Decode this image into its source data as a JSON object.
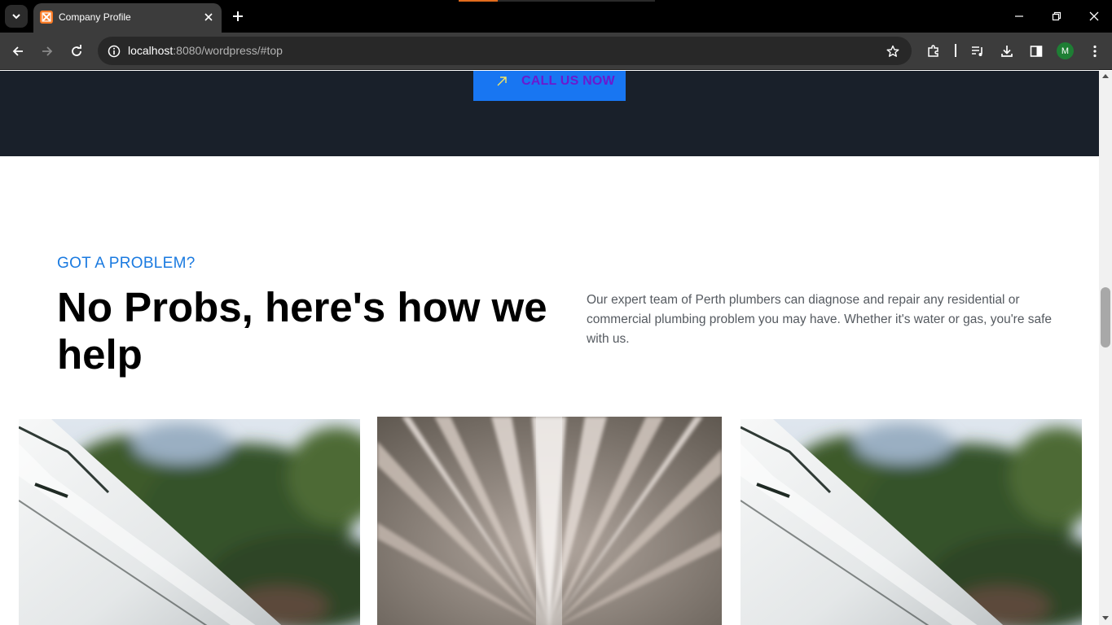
{
  "browser": {
    "tab": {
      "title": "Company Profile",
      "favicon": "xampp-icon"
    },
    "address": {
      "host": "localhost",
      "rest": ":8080/wordpress/#top"
    },
    "profile_initial": "M",
    "colors": {
      "tabbar": "#000000",
      "toolbar": "#3c3c3c",
      "omnibox": "#282828",
      "favicon": "#fb7a24",
      "avatar": "#1e7e34"
    }
  },
  "page": {
    "cta": {
      "label": "CALL US NOW",
      "icon": "arrow-up-right-icon"
    },
    "section": {
      "eyebrow": "GOT A PROBLEM?",
      "headline": "No Probs, here's how we help",
      "intro": "Our expert team of Perth plumbers can diagnose and repair any residential or commercial plumbing problem you may have. Whether it's water or gas, you're safe with us."
    },
    "cards": [
      {
        "image": "roof-gutter-photo"
      },
      {
        "image": "water-spray-photo"
      },
      {
        "image": "roof-gutter-photo"
      }
    ],
    "colors": {
      "dark_band": "#19202a",
      "cta_bg": "#1876f2",
      "cta_text": "#6a1ad0",
      "eyebrow": "#1a7ae0",
      "headline": "#000000",
      "body_text": "#555a60"
    }
  }
}
